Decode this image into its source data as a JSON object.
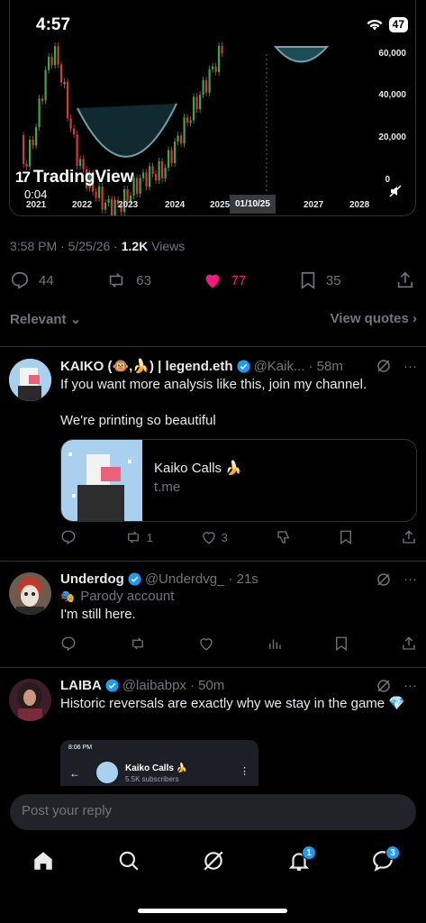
{
  "status": {
    "time": "4:57",
    "battery": "47"
  },
  "chart": {
    "y_ticks": [
      "60,000",
      "40,000",
      "20,000",
      "0"
    ],
    "x_ticks": [
      "2021",
      "2022",
      "2023",
      "2024",
      "2025",
      "2027",
      "2028"
    ],
    "x_highlight": "01/10/25",
    "logo_text": "TradingView",
    "video_time": "0:04"
  },
  "post": {
    "time": "3:58 PM · 5/25/26 · ",
    "views_count": "1.2K",
    "views_label": " Views",
    "replies": "44",
    "reposts": "63",
    "likes": "77",
    "bookmarks": "35"
  },
  "sort": {
    "relevant": "Relevant",
    "view_quotes": "View quotes"
  },
  "replies": [
    {
      "name": "KAIKO (🐵,🍌) | legend.eth",
      "handle": "@Kaik...",
      "time": "· 58m",
      "text1": "If you want more analysis like this, join my channel.",
      "text2": "We're printing so beautiful",
      "card_title": "Kaiko Calls 🍌",
      "card_domain": "t.me",
      "reposts": "1",
      "likes": "3"
    },
    {
      "name": "Underdog",
      "handle": "@Underdvg_",
      "time": "· 21s",
      "parody": "Parody account",
      "text": "I'm still here."
    },
    {
      "name": "LAIBA",
      "handle": "@laibabpx",
      "time": "· 50m",
      "text": "Historic reversals are exactly why we stay in the game 💎",
      "embed_time": "8:06 PM",
      "embed_title": "Kaiko Calls 🍌",
      "embed_sub": "5.5K subscribers"
    }
  ],
  "composer": {
    "placeholder": "Post your reply"
  },
  "tabs": {
    "notifications_badge": "1",
    "messages_badge": "3"
  }
}
